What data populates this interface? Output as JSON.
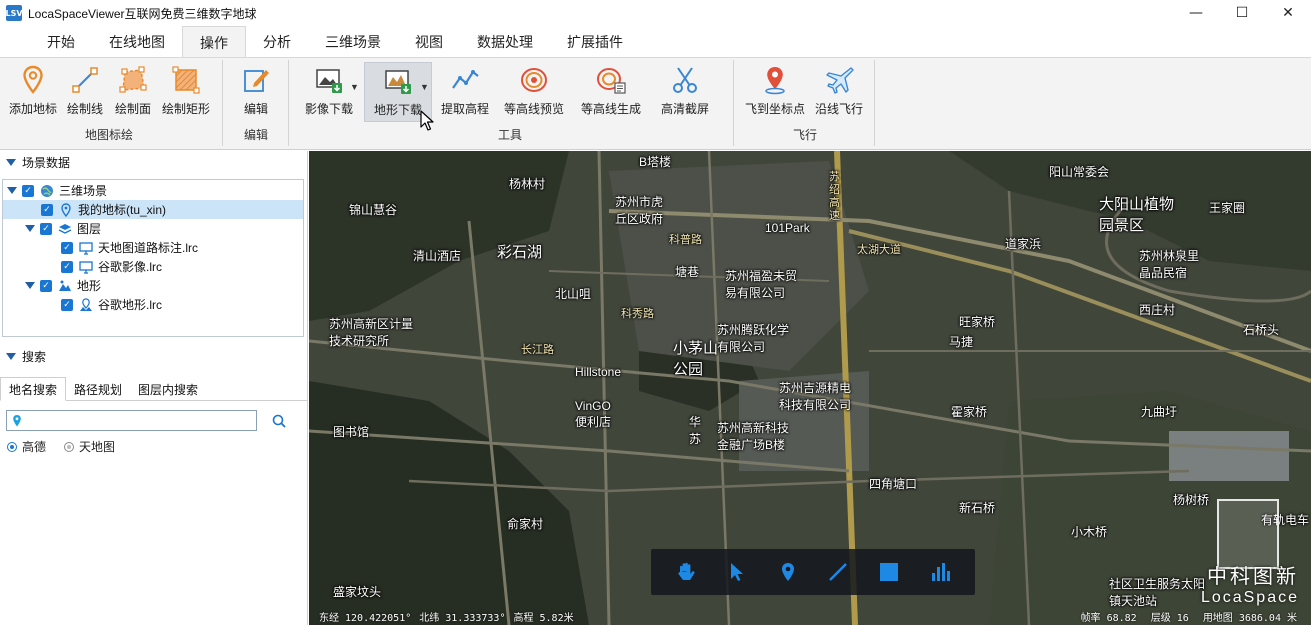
{
  "window": {
    "app_icon_text": "LSV",
    "title": "LocaSpaceViewer互联网免费三维数字地球",
    "controls": {
      "minimize": "—",
      "maximize": "☐",
      "close": "✕"
    }
  },
  "menu_tabs": [
    "开始",
    "在线地图",
    "操作",
    "分析",
    "三维场景",
    "视图",
    "数据处理",
    "扩展插件"
  ],
  "active_menu_tab": "操作",
  "ribbon": {
    "groups": {
      "map_mark": "地图标绘",
      "edit": "编辑",
      "tools": "工具",
      "fly": "飞行"
    },
    "buttons": {
      "add_mark": "添加地标",
      "draw_line": "绘制线",
      "draw_polygon": "绘制面",
      "draw_rect": "绘制矩形",
      "edit": "编辑",
      "image_download": "影像下载",
      "terrain_download": "地形下载",
      "extract_elevation": "提取高程",
      "contour_preview": "等高线预览",
      "contour_generate": "等高线生成",
      "hd_screenshot": "高清截屏",
      "fly_to_point": "飞到坐标点",
      "fly_along_line": "沿线飞行"
    }
  },
  "scene_panel": {
    "title": "场景数据",
    "tree": [
      {
        "label": "三维场景",
        "level": 0,
        "icon": "globe-icon"
      },
      {
        "label": "我的地标(tu_xin)",
        "level": 1,
        "icon": "pin-icon",
        "selected": true
      },
      {
        "label": "图层",
        "level": 1,
        "icon": "layers-icon"
      },
      {
        "label": "天地图道路标注.lrc",
        "level": 2,
        "icon": "monitor-icon"
      },
      {
        "label": "谷歌影像.lrc",
        "level": 2,
        "icon": "monitor-icon"
      },
      {
        "label": "地形",
        "level": 1,
        "icon": "terrain-icon"
      },
      {
        "label": "谷歌地形.lrc",
        "level": 2,
        "icon": "terrain-file-icon"
      }
    ]
  },
  "search_panel": {
    "title": "搜索",
    "tabs": [
      "地名搜索",
      "路径规划",
      "图层内搜索"
    ],
    "active_tab": "地名搜索",
    "input_value": "",
    "radios": [
      {
        "label": "高德",
        "checked": true
      },
      {
        "label": "天地图",
        "checked": false
      }
    ]
  },
  "map": {
    "labels": [
      {
        "t": "B塔楼"
      },
      {
        "t": "杨林村"
      },
      {
        "t": "苏州市虎丘区政府"
      },
      {
        "t": "锦山慧谷"
      },
      {
        "t": "清山酒店"
      },
      {
        "t": "彩石湖"
      },
      {
        "t": "科普路"
      },
      {
        "t": "塘巷"
      },
      {
        "t": "苏州福盈未贸易有限公司"
      },
      {
        "t": "101Park"
      },
      {
        "t": "苏绍高速"
      },
      {
        "t": "太湖大道"
      },
      {
        "t": "阳山常委会"
      },
      {
        "t": "大阳山植物园景区"
      },
      {
        "t": "王家圈"
      },
      {
        "t": "道家浜"
      },
      {
        "t": "苏州林泉里晶品民宿"
      },
      {
        "t": "北山咀"
      },
      {
        "t": "科秀路"
      },
      {
        "t": "苏州高新区计量技术研究所"
      },
      {
        "t": "苏州腾跃化学有限公司"
      },
      {
        "t": "小茅山公园"
      },
      {
        "t": "旺家桥"
      },
      {
        "t": "马捷"
      },
      {
        "t": "西庄村"
      },
      {
        "t": "石桥头"
      },
      {
        "t": "长江路"
      },
      {
        "t": "Hillstone"
      },
      {
        "t": "苏州吉源精电科技有限公司"
      },
      {
        "t": "霍家桥"
      },
      {
        "t": "九曲圩"
      },
      {
        "t": "VinGO便利店"
      },
      {
        "t": "华苏"
      },
      {
        "t": "苏州高新科技金融广场B楼"
      },
      {
        "t": "图书馆"
      },
      {
        "t": "四角塘口"
      },
      {
        "t": "新石桥"
      },
      {
        "t": "杨树桥"
      },
      {
        "t": "小木桥"
      },
      {
        "t": "俞家村"
      },
      {
        "t": "盛家坟头"
      },
      {
        "t": "社区卫生服务太阳镇天池站"
      },
      {
        "t": "有轨电车"
      }
    ],
    "tools": [
      "hand-icon",
      "pointer-icon",
      "pin-icon",
      "line-icon",
      "polygon-icon",
      "chart-icon"
    ],
    "status": {
      "lon": "东经 120.422051°",
      "lat": "北纬 31.333733°",
      "alt": "高程 5.82米",
      "fps": "帧率 68.82",
      "level": "层级 16",
      "range": "用地图 3686.04 米"
    },
    "watermark_line1": "中科图新",
    "watermark_line2": "LocaSpace"
  }
}
